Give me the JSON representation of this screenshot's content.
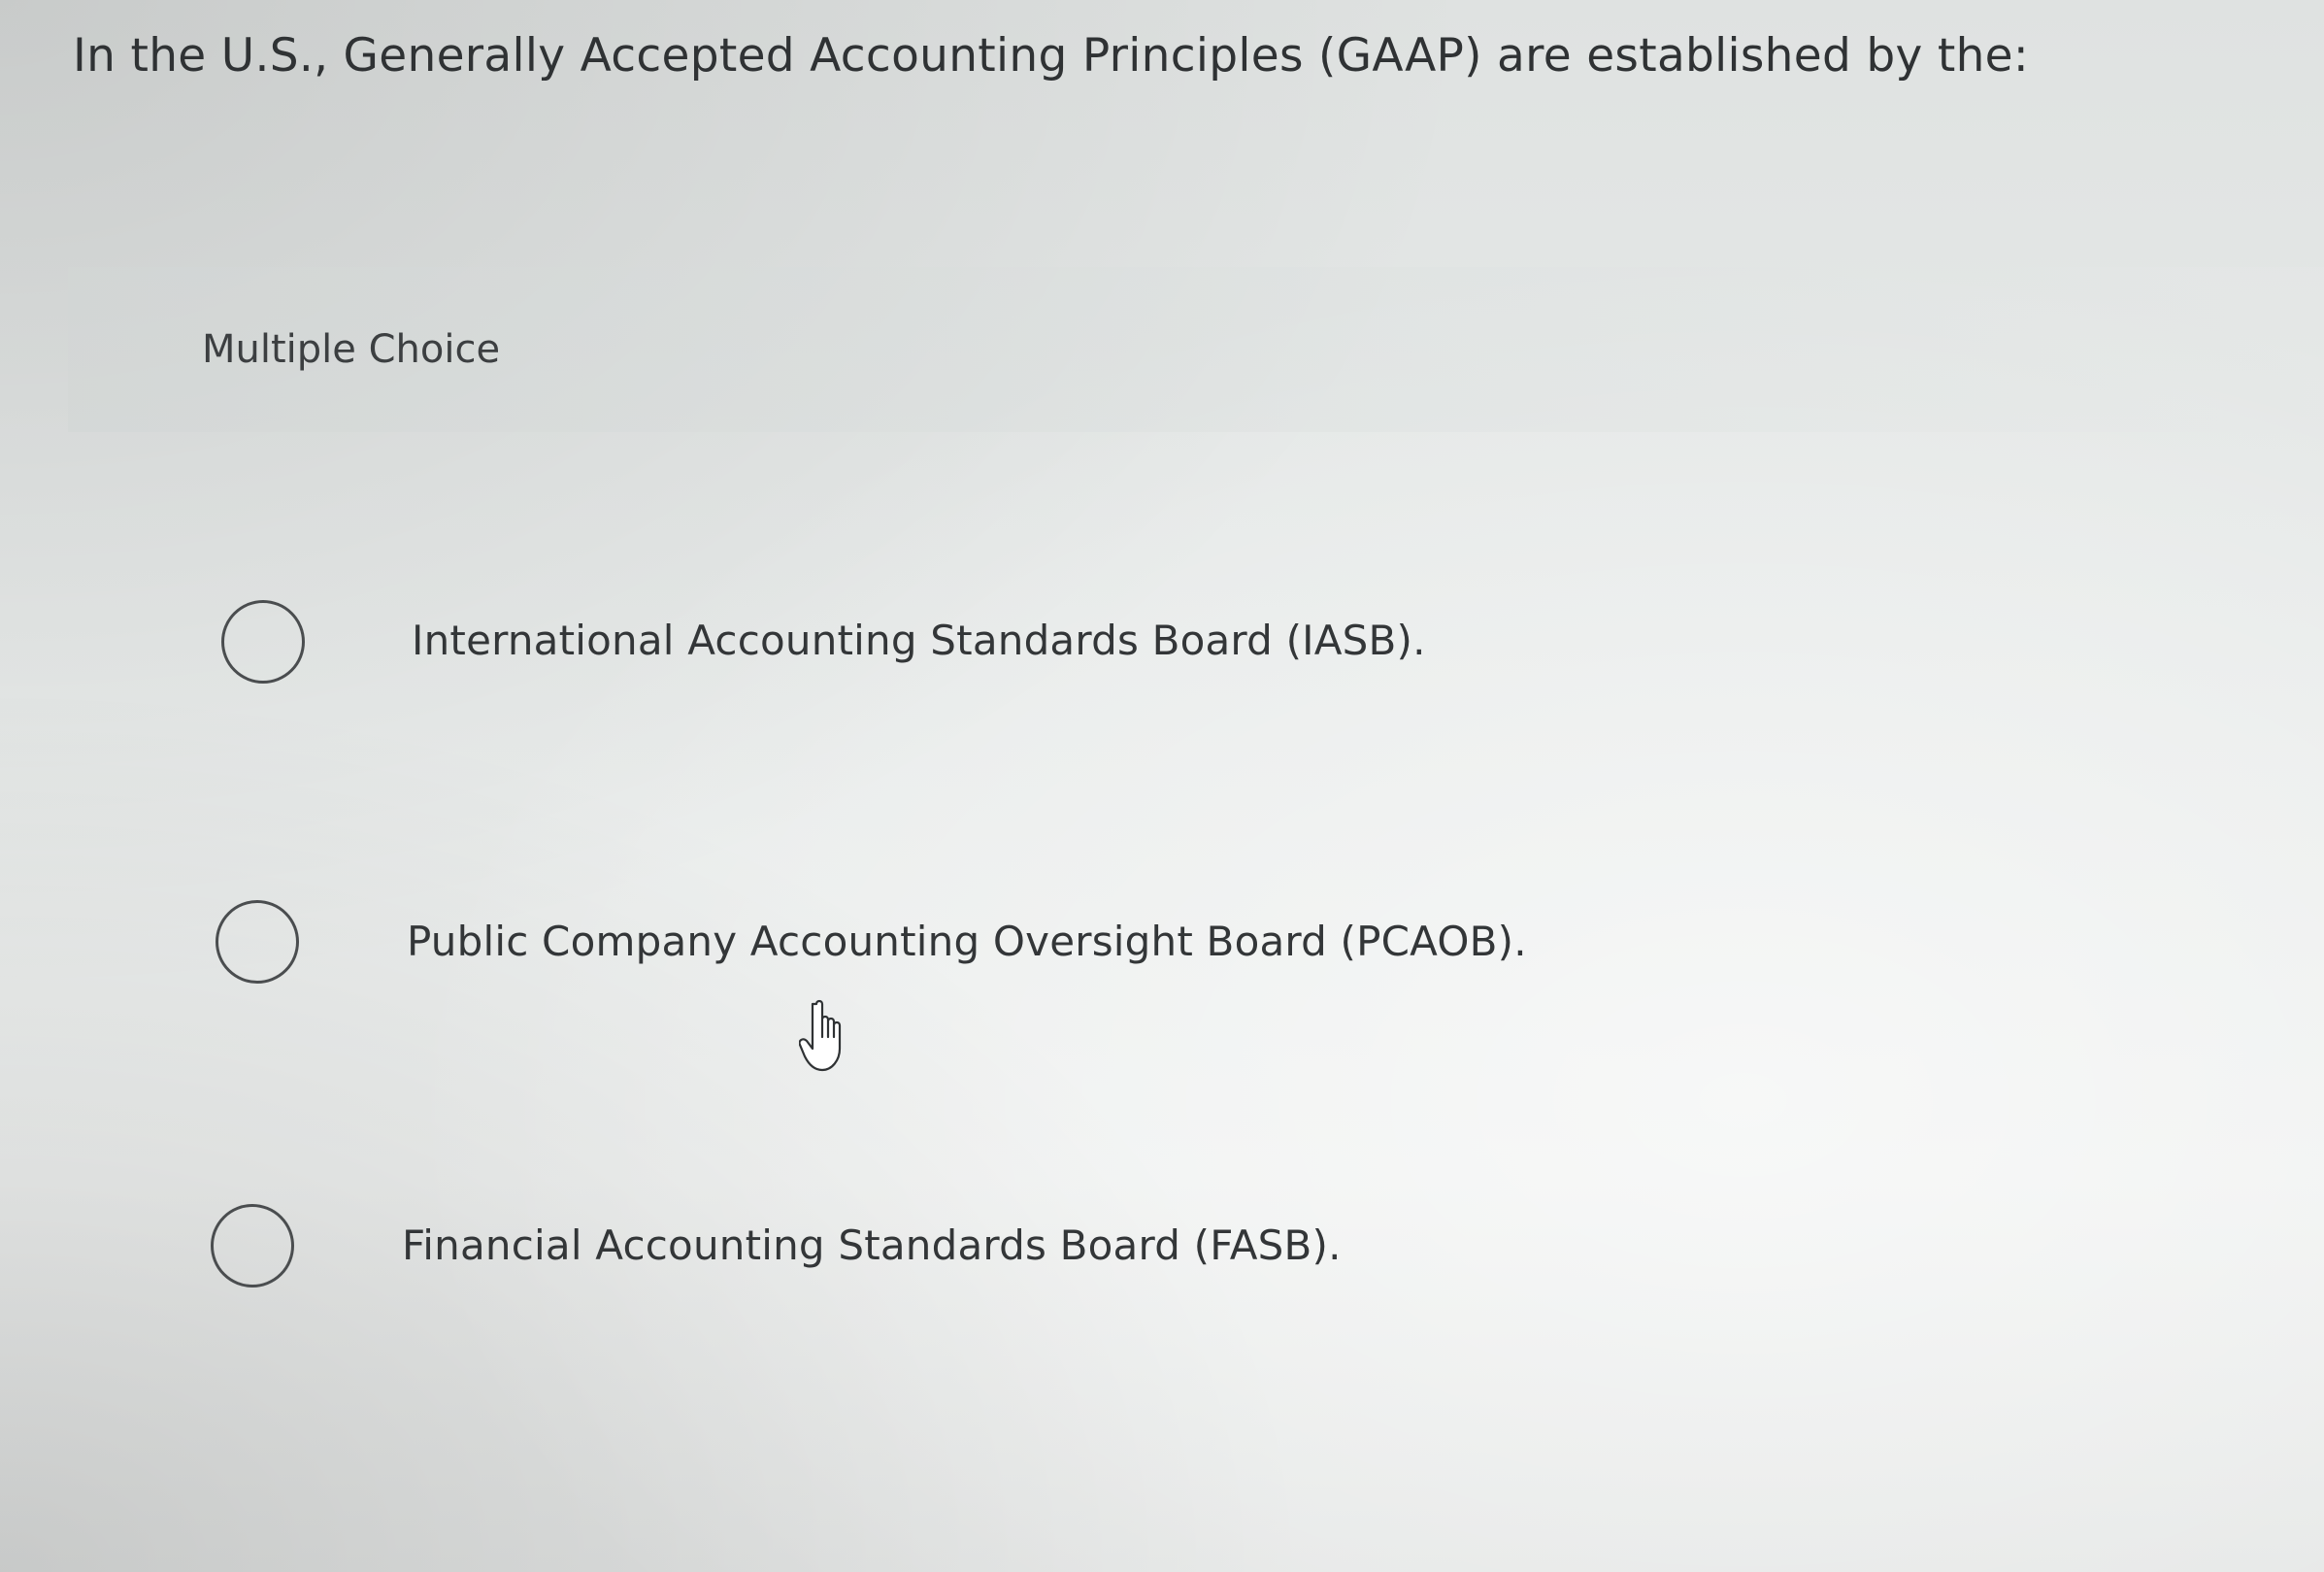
{
  "question": {
    "text": "In the U.S., Generally Accepted Accounting Principles (GAAP) are established by the:"
  },
  "section": {
    "label": "Multiple Choice"
  },
  "options": [
    {
      "text": "International Accounting Standards Board (IASB).",
      "selected": false
    },
    {
      "text": "Public Company Accounting Oversight Board (PCAOB).",
      "selected": false
    },
    {
      "text": "Financial Accounting Standards Board (FASB).",
      "selected": false
    }
  ],
  "cursor": {
    "icon": "hand-pointer-icon"
  }
}
